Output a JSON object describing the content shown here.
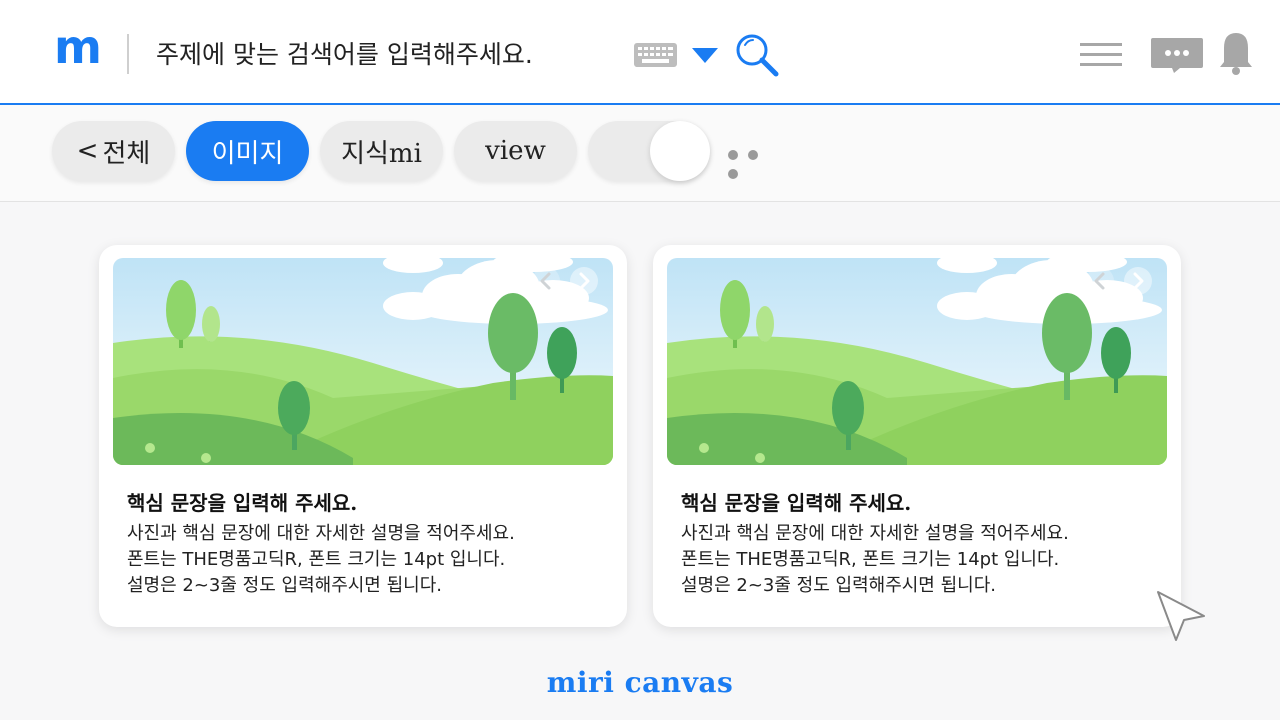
{
  "header": {
    "logo": "m",
    "search": {
      "placeholder": "주제에 맞는 검색어를 입력해주세요.",
      "value": ""
    },
    "icons": [
      "keyboard-icon",
      "dropdown-triangle-icon",
      "search-icon",
      "hamburger-menu-icon",
      "chat-icon",
      "bell-icon"
    ]
  },
  "tabs": [
    {
      "label": "전체",
      "icon": "chevron-left-icon",
      "active": false
    },
    {
      "label": "이미지",
      "active": true
    },
    {
      "label": "지식mi",
      "active": false
    },
    {
      "label": "view",
      "active": false
    }
  ],
  "toggle": {
    "on": true
  },
  "cards": [
    {
      "title": "핵심 문장을 입력해 주세요.",
      "desc": [
        "사진과 핵심 문장에 대한 자세한 설명을 적어주세요.",
        "폰트는 THE명품고딕R, 폰트 크기는 14pt 입니다.",
        "설명은 2~3줄 정도 입력해주시면 됩니다."
      ]
    },
    {
      "title": "핵심 문장을 입력해 주세요.",
      "desc": [
        "사진과 핵심 문장에 대한 자세한 설명을 적어주세요.",
        "폰트는 THE명품고딕R, 폰트 크기는 14pt 입니다.",
        "설명은 2~3줄 정도 입력해주시면 됩니다."
      ]
    }
  ],
  "footer": {
    "brand": "miri canvas"
  },
  "colors": {
    "accent": "#1a7cf2",
    "tab_bg": "#ebebeb",
    "icon_gray": "#9a9a9a"
  }
}
